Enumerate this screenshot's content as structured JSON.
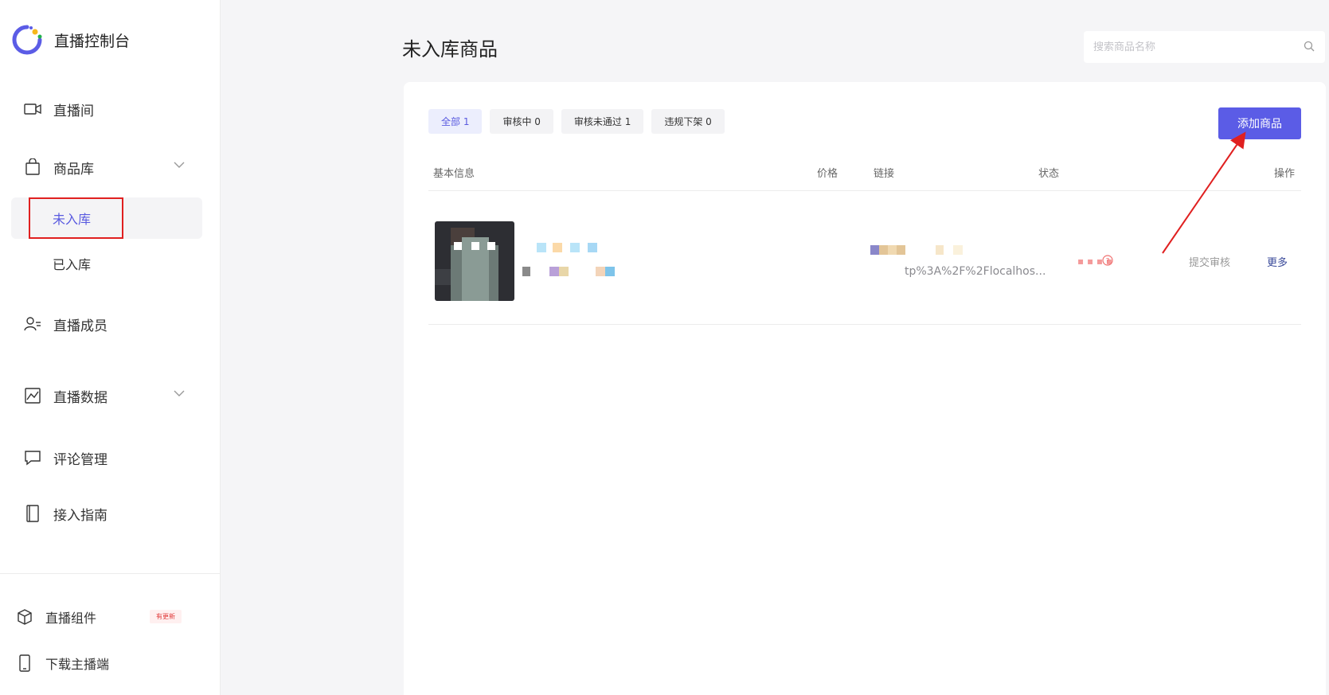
{
  "app": {
    "title": "直播控制台"
  },
  "sidebar": {
    "items": [
      {
        "label": "直播间",
        "icon": "video-camera-icon"
      },
      {
        "label": "商品库",
        "icon": "shopping-bag-icon"
      },
      {
        "label": "直播成员",
        "icon": "user-list-icon"
      },
      {
        "label": "直播数据",
        "icon": "chart-icon"
      },
      {
        "label": "评论管理",
        "icon": "comment-icon"
      },
      {
        "label": "接入指南",
        "icon": "book-icon"
      }
    ],
    "sub_items": [
      {
        "label": "未入库"
      },
      {
        "label": "已入库"
      }
    ],
    "footer": [
      {
        "label": "直播组件",
        "icon": "cube-icon",
        "badge": "有更新"
      },
      {
        "label": "下载主播端",
        "icon": "phone-icon"
      }
    ]
  },
  "page": {
    "title": "未入库商品"
  },
  "search": {
    "placeholder": "搜索商品名称"
  },
  "tabs": [
    {
      "label": "全部 1"
    },
    {
      "label": "审核中 0"
    },
    {
      "label": "审核未通过 1"
    },
    {
      "label": "违规下架 0"
    }
  ],
  "toolbar": {
    "add_label": "添加商品"
  },
  "table": {
    "columns": [
      "基本信息",
      "价格",
      "链接",
      "状态",
      "操作"
    ],
    "rows": [
      {
        "link": "tp%3A%2F%2Flocalhos...",
        "actions": [
          "提交审核",
          "更多"
        ]
      }
    ]
  },
  "colors": {
    "accent": "#5b5ce6",
    "annotation": "#e02020"
  }
}
